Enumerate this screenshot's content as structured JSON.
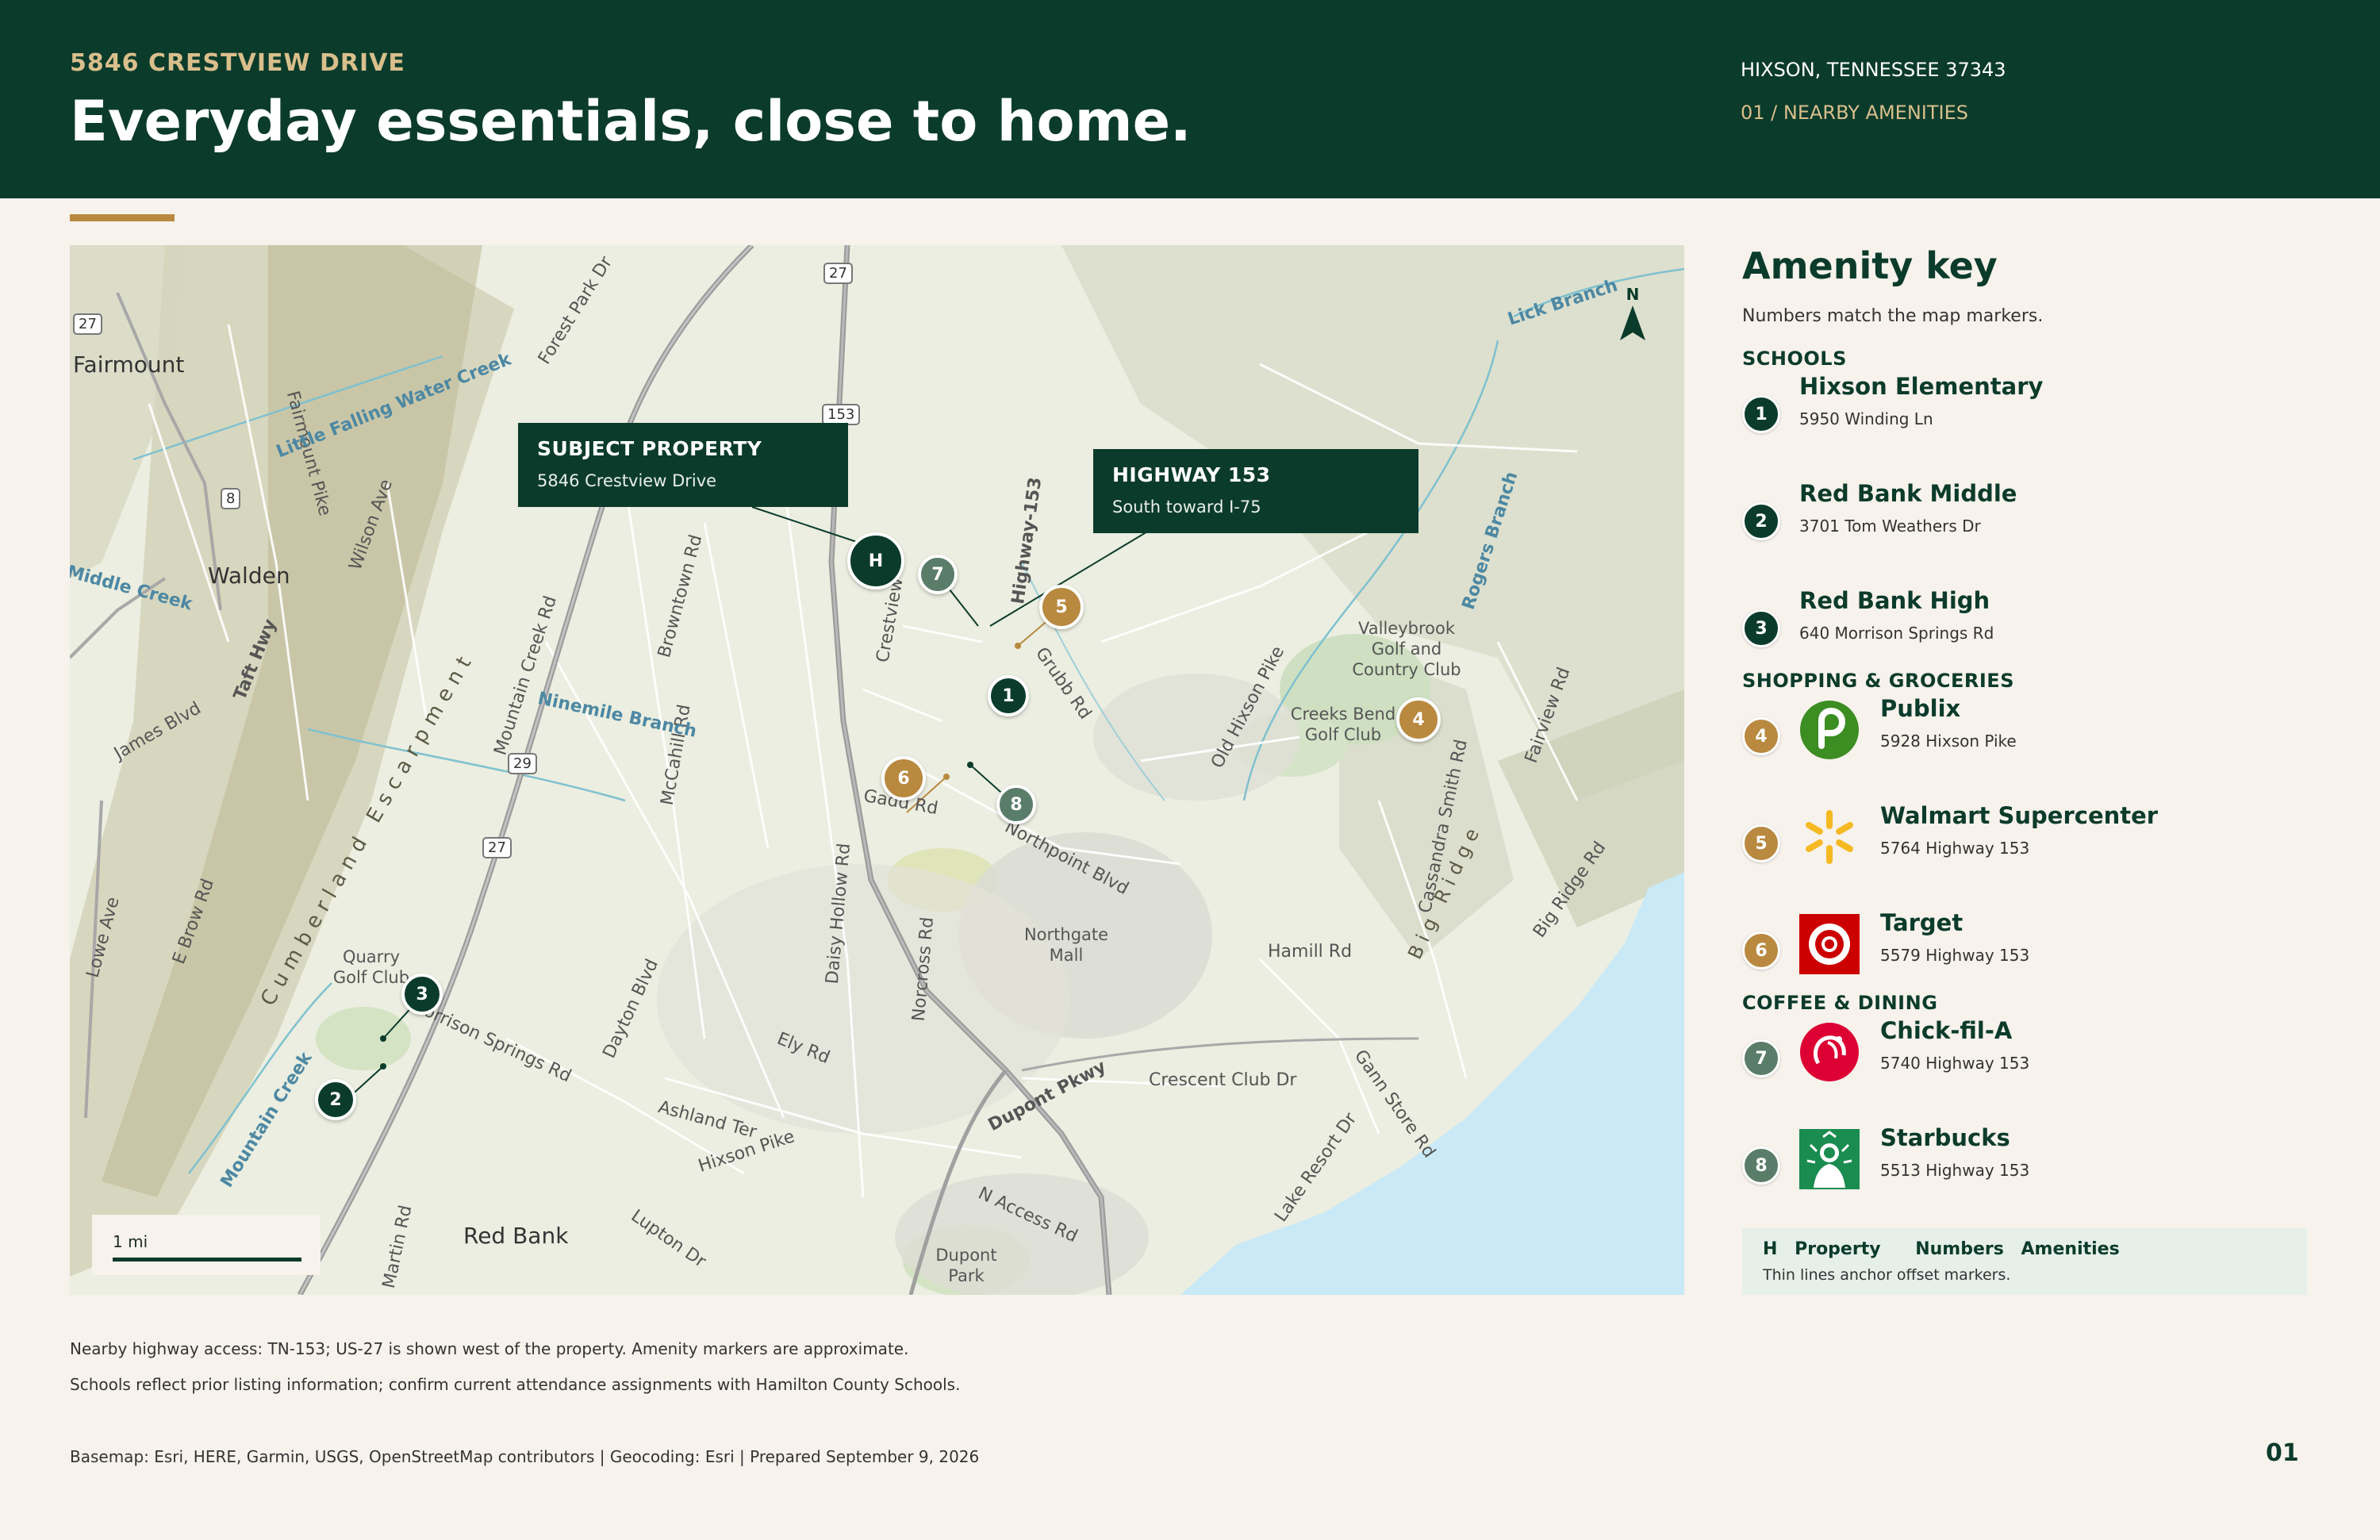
{
  "header": {
    "eyebrow": "5846 CRESTVIEW DRIVE",
    "headline": "Everyday essentials, close to home.",
    "location": "HIXSON, TENNESSEE 37343",
    "section": "01 / NEARBY AMENITIES"
  },
  "colors": {
    "brand_green": "#0b3b2b",
    "accent_gold": "#b8893f",
    "dining_green": "#5a7d6a",
    "background": "#f7f2ec",
    "water": "#c9e9f6"
  },
  "map": {
    "callouts": {
      "subject_title": "SUBJECT PROPERTY",
      "subject_sub": "5846 Crestview Drive",
      "highway_title": "HIGHWAY 153",
      "highway_sub": "South toward I-75"
    },
    "property_marker": "H",
    "markers": [
      "1",
      "2",
      "3",
      "4",
      "5",
      "6",
      "7",
      "8"
    ],
    "north_label": "N",
    "scale_label": "1 mi",
    "places": {
      "fairmount": "Fairmount",
      "walden": "Walden",
      "red_bank": "Red Bank",
      "valleybrook": "Valleybrook Golf and Country Club",
      "creeks_bend": "Creeks Bend Golf Club",
      "quarry": "Quarry Golf Club",
      "northgate": "Northgate Mall",
      "dupont_park": "Dupont Park"
    },
    "roads": {
      "hwy153": "Highway-153",
      "dupont": "Dupont Pkwy",
      "hixson_pike": "Hixson Pike",
      "old_hixson": "Old Hixson Pike",
      "northpoint": "Northpoint Blvd",
      "hamill": "Hamill Rd",
      "crescent_club": "Crescent Club Dr",
      "gann_store": "Gann Store Rd",
      "lake_resort": "Lake Resort Dr",
      "access": "N Access Rd",
      "ely": "Ely Rd",
      "ashland": "Ashland Ter",
      "morrison": "Morrison Springs Rd",
      "dayton": "Dayton Blvd",
      "norcross": "Norcross Rd",
      "daisy_hollow": "Daisy Hollow Rd",
      "mountain_creek": "Mountain Creek Rd",
      "browntown": "Browntown Rd",
      "mccahill": "McCahill Rd",
      "wilson": "Wilson Ave",
      "taft": "Taft Hwy",
      "james": "James Blvd",
      "fairmount_pike": "Fairmount Pike",
      "forest_park": "Forest Park Dr",
      "cassandra": "Cassandra Smith Rd",
      "big_ridge_rd": "Big Ridge Rd",
      "fairview": "Fairview Rd",
      "grubb": "Grubb Rd",
      "gadd": "Gadd Rd",
      "crestview": "Crestview",
      "lupton": "Lupton Dr",
      "martin": "Martin Rd",
      "lowe": "Lowe Ave",
      "ebrow": "E Brow Rd"
    },
    "waters": {
      "little_falling": "Little Falling Water Creek",
      "ninemile": "Ninemile Branch",
      "middle_creek": "Middle Creek",
      "mountain_creek": "Mountain Creek",
      "rogers": "Rogers Branch",
      "lick": "Lick Branch"
    },
    "terrain": {
      "escarpment": "Cumberland Escarpment",
      "big_ridge": "Big Ridge"
    },
    "shields": [
      "27",
      "153",
      "8",
      "29",
      "27",
      "27"
    ]
  },
  "key": {
    "title": "Amenity key",
    "subtitle": "Numbers match the map markers.",
    "categories": {
      "schools": "SCHOOLS",
      "shopping": "SHOPPING & GROCERIES",
      "dining": "COFFEE & DINING"
    },
    "items": [
      {
        "num": "1",
        "name": "Hixson Elementary",
        "addr": "5950 Winding Ln",
        "icon": "school-marker"
      },
      {
        "num": "2",
        "name": "Red Bank Middle",
        "addr": "3701 Tom Weathers Dr",
        "icon": "school-marker"
      },
      {
        "num": "3",
        "name": "Red Bank High",
        "addr": "640 Morrison Springs Rd",
        "icon": "school-marker"
      },
      {
        "num": "4",
        "name": "Publix",
        "addr": "5928 Hixson Pike",
        "icon": "publix-logo"
      },
      {
        "num": "5",
        "name": "Walmart Supercenter",
        "addr": "5764 Highway 153",
        "icon": "walmart-logo"
      },
      {
        "num": "6",
        "name": "Target",
        "addr": "5579 Highway 153",
        "icon": "target-logo"
      },
      {
        "num": "7",
        "name": "Chick-fil-A",
        "addr": "5740 Highway 153",
        "icon": "chick-fil-a-logo"
      },
      {
        "num": "8",
        "name": "Starbucks",
        "addr": "5513 Highway 153",
        "icon": "starbucks-logo"
      }
    ],
    "legend": {
      "h": "H",
      "property": "Property",
      "numbers": "Numbers",
      "amenities": "Amenities",
      "note": "Thin lines anchor offset markers."
    }
  },
  "footer": {
    "note1": "Nearby highway access: TN-153; US-27 is shown west of the property. Amenity markers are approximate.",
    "note2": "Schools reflect prior listing information; confirm current attendance assignments with Hamilton County Schools.",
    "credits": "Basemap: Esri, HERE, Garmin, USGS, OpenStreetMap contributors | Geocoding: Esri | Prepared September 9, 2026",
    "page": "01"
  }
}
